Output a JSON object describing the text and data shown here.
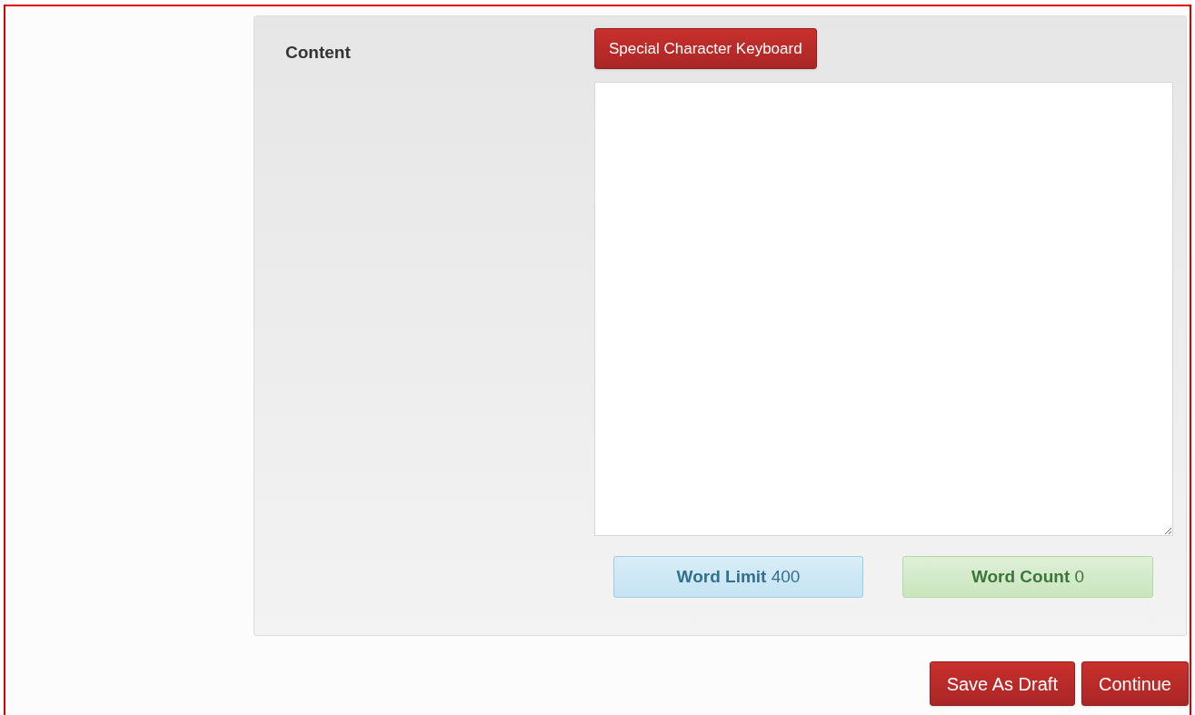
{
  "form": {
    "label": "Content",
    "keyboard_button": "Special Character Keyboard",
    "word_limit": {
      "label": "Word Limit",
      "value": "400"
    },
    "word_count": {
      "label": "Word Count",
      "value": "0"
    }
  },
  "actions": [
    {
      "label": "Save As Draft"
    },
    {
      "label": "Continue"
    }
  ]
}
